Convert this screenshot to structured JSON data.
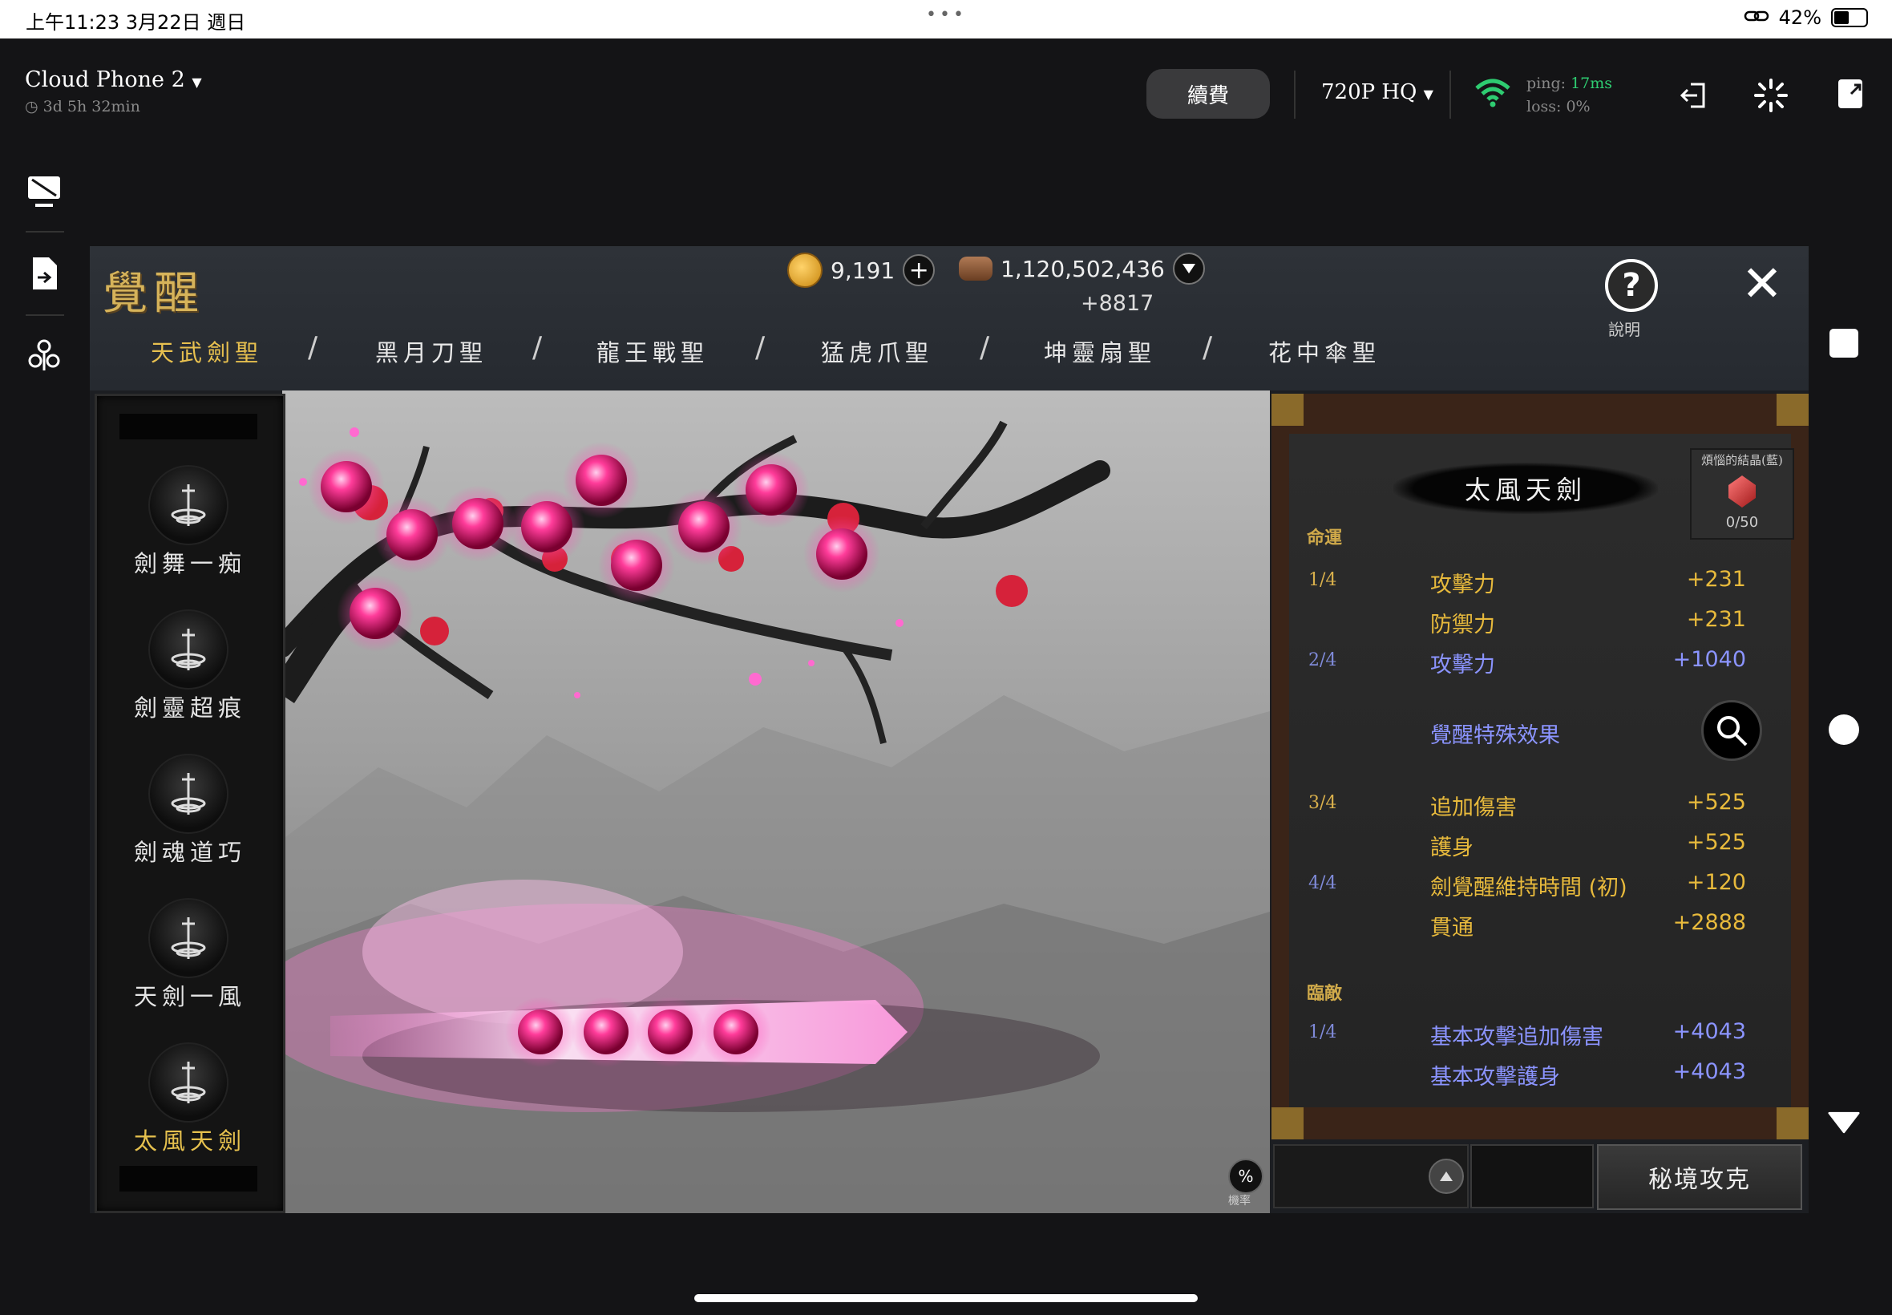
{
  "status_bar": {
    "time": "上午11:23  3月22日 週日",
    "dots": "•••",
    "battery": "42%",
    "battery_level": 0.42
  },
  "toolbar": {
    "device_name": "Cloud Phone 2",
    "uptime": "3d 5h 32min",
    "renew_label": "續費",
    "quality_label": "720P HQ",
    "ping_label": "ping:",
    "ping_value": "17ms",
    "loss_label": "loss: 0%",
    "icons": [
      "exit-icon",
      "loading-icon",
      "app-switch-icon"
    ]
  },
  "sidebar": {
    "icons": [
      "screen-off-icon",
      "file-transfer-icon",
      "settings-icon"
    ]
  },
  "right_controls": {
    "icons": [
      "square-icon",
      "circle-icon",
      "triangle-icon"
    ]
  },
  "game": {
    "title": "覺醒",
    "gold": "9,191",
    "gems": "1,120,502,436",
    "gem_bonus": "+8817",
    "help_label": "說明",
    "close_glyph": "✕",
    "tabs": [
      {
        "label": "天武劍聖",
        "active": true
      },
      {
        "label": "黑月刀聖",
        "active": false
      },
      {
        "label": "龍王戰聖",
        "active": false
      },
      {
        "label": "猛虎爪聖",
        "active": false
      },
      {
        "label": "坤靈扇聖",
        "active": false
      },
      {
        "label": "花中傘聖",
        "active": false
      }
    ],
    "skills": [
      {
        "label": "劍舞一痴",
        "active": false
      },
      {
        "label": "劍靈超痕",
        "active": false
      },
      {
        "label": "劍魂道巧",
        "active": false
      },
      {
        "label": "天劍一風",
        "active": false
      },
      {
        "label": "太風天劍",
        "active": true
      }
    ],
    "panel": {
      "title": "太風天劍",
      "crystal_title": "煩惱的結晶(藍)",
      "crystal_count": "0/50",
      "section_fate": "命運",
      "section_battle": "臨敵",
      "special_effect": "覺醒特殊效果",
      "rows": [
        {
          "lvl": "1/4",
          "stat": "攻擊力",
          "val": "+231",
          "color": "y"
        },
        {
          "lvl": "",
          "stat": "防禦力",
          "val": "+231",
          "color": "y"
        },
        {
          "lvl": "2/4",
          "stat": "攻擊力",
          "val": "+1040",
          "color": "b"
        },
        {
          "lvl": "3/4",
          "stat": "追加傷害",
          "val": "+525",
          "color": "y"
        },
        {
          "lvl": "",
          "stat": "護身",
          "val": "+525",
          "color": "y"
        },
        {
          "lvl": "4/4",
          "stat": "劍覺醒維持時間 (初)",
          "val": "+120",
          "color": "y"
        },
        {
          "lvl": "",
          "stat": "貫通",
          "val": "+2888",
          "color": "y"
        },
        {
          "lvl": "1/4",
          "stat": "基本攻擊追加傷害",
          "val": "+4043",
          "color": "b"
        },
        {
          "lvl": "",
          "stat": "基本攻擊護身",
          "val": "+4043",
          "color": "b"
        }
      ]
    },
    "percent_icon": "%",
    "percent_label": "機率",
    "secret_button": "秘境攻克"
  }
}
